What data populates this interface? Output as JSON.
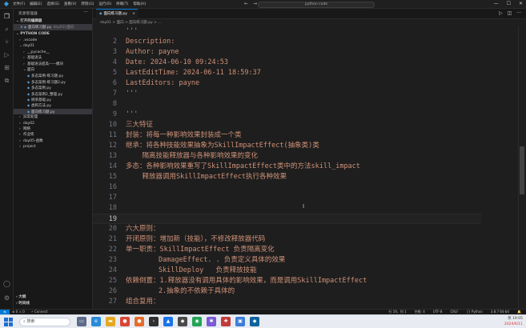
{
  "titlebar": {
    "menu": [
      "文件(F)",
      "编辑(E)",
      "选择(S)",
      "查看(V)",
      "转到(G)",
      "运行(R)",
      "终端(T)",
      "帮助(H)"
    ],
    "nav": [
      "←",
      "→"
    ],
    "search": "python code",
    "window_controls": [
      "—",
      "☐",
      "✕"
    ]
  },
  "sidebar": {
    "title": "资源管理器",
    "open_editors_label": "打开的编辑器",
    "open_editor_file": "面向练习题.py",
    "open_editor_desc": "day01\\\\面向",
    "project_label": "PYTHON CODE",
    "items": [
      {
        "label": ".vscode",
        "kind": "folder",
        "indent": 1
      },
      {
        "label": "day01",
        "kind": "folder-open",
        "indent": 1
      },
      {
        "label": "__pycache__",
        "kind": "folder",
        "indent": 2
      },
      {
        "label": "基础语法",
        "kind": "folder",
        "indent": 2
      },
      {
        "label": "基础语法提高——模块",
        "kind": "folder",
        "indent": 2
      },
      {
        "label": "面向",
        "kind": "folder-open",
        "indent": 2
      },
      {
        "label": "多态案例-练习题.py",
        "kind": "py",
        "indent": 3
      },
      {
        "label": "多态案例-练习题2.py",
        "kind": "py",
        "indent": 3
      },
      {
        "label": "多态案例.py",
        "kind": "py",
        "indent": 3
      },
      {
        "label": "多态案例2_整理.py",
        "kind": "py",
        "indent": 3
      },
      {
        "label": "继承基础.py",
        "kind": "py",
        "indent": 3
      },
      {
        "label": "类和方法.py",
        "kind": "py",
        "indent": 3
      },
      {
        "label": "面向练习题.py",
        "kind": "py",
        "indent": 3,
        "selected": true
      },
      {
        "label": "异常处理",
        "kind": "folder",
        "indent": 1
      },
      {
        "label": "day02",
        "kind": "folder",
        "indent": 1
      },
      {
        "label": "网络",
        "kind": "folder",
        "indent": 1
      },
      {
        "label": "作业练",
        "kind": "folder",
        "indent": 1
      },
      {
        "label": "day05-函数",
        "kind": "folder",
        "indent": 1
      },
      {
        "label": "project",
        "kind": "folder",
        "indent": 1
      }
    ],
    "outline_label": "大纲",
    "timeline_label": "时间线"
  },
  "tab": {
    "label": "面向练习题.py",
    "close": "×"
  },
  "breadcrumb": "day01 > 面向 > 面向练习题.py > ...",
  "editor": {
    "lines": [
      {
        "n": "",
        "text": "'''"
      },
      {
        "n": "2",
        "text": "Description:"
      },
      {
        "n": "3",
        "text": "Author: payne"
      },
      {
        "n": "4",
        "text": "Date: 2024-06-10 09:24:53"
      },
      {
        "n": "5",
        "text": "LastEditTime: 2024-06-11 18:59:37"
      },
      {
        "n": "6",
        "text": "LastEditors: payne"
      },
      {
        "n": "7",
        "text": "'''"
      },
      {
        "n": "8",
        "text": ""
      },
      {
        "n": "9",
        "text": "'''"
      },
      {
        "n": "10",
        "text": "三大特征"
      },
      {
        "n": "11",
        "text": "封装：将每一种影响效果封装成一个类"
      },
      {
        "n": "12",
        "text": "继承：将各种技能效果抽象为SkillImpactEffect(抽象类)类"
      },
      {
        "n": "13",
        "text": "    隔离技能释放器与各种影响效果的变化"
      },
      {
        "n": "14",
        "text": "多态：各种影响效果重写了SkillImpactEffect类中的方法skill_impact"
      },
      {
        "n": "15",
        "text": "    释放器调用SkillImpactEffect执行各种效果"
      },
      {
        "n": "16",
        "text": ""
      },
      {
        "n": "17",
        "text": ""
      },
      {
        "n": "18",
        "text": ""
      },
      {
        "n": "19",
        "text": ""
      },
      {
        "n": "20",
        "text": "六大原则："
      },
      {
        "n": "21",
        "text": "开闭原则：增加新（技能），不修改释放器代码"
      },
      {
        "n": "22",
        "text": "单一职责：SkillImpactEffect 负责隔离变化"
      },
      {
        "n": "23",
        "text": "        DamageEffect. . 负责定义具体的效果"
      },
      {
        "n": "24",
        "text": "        SkillDeploy   负责释放技能"
      },
      {
        "n": "25",
        "text": "依赖倒置：1.释放器没有调用具体的影响效果，而是调用SkillImpactEffect"
      },
      {
        "n": "26",
        "text": "        2.抽象的不依赖于具体的"
      },
      {
        "n": "27",
        "text": "组合复用："
      }
    ],
    "current_line_number": "19"
  },
  "statusbar": {
    "left": [
      "⊗ 0 ⚠ 0",
      "⚡ Connect"
    ],
    "right": [
      "行 19，列 1",
      "空格: 4",
      "UTF-8",
      "CRLF",
      "{} Python",
      "3.8.7 64-bit",
      "🔔"
    ]
  },
  "taskbar": {
    "search_placeholder": "搜索",
    "date": "2024/6/11",
    "time": "19:05",
    "lang": "英"
  }
}
